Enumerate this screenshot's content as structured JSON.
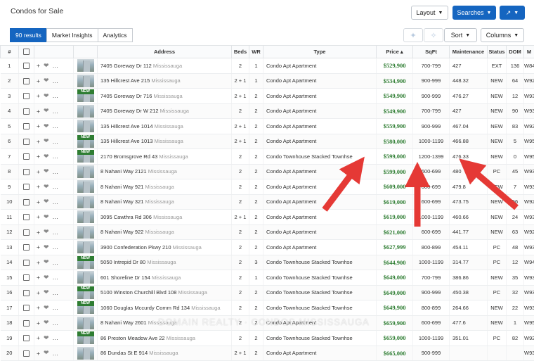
{
  "header": {
    "title": "Condos for Sale",
    "layout_label": "Layout",
    "searches_label": "Searches",
    "share_icon_label": "↗"
  },
  "tabs": [
    {
      "label": "90 results",
      "active": true
    },
    {
      "label": "Market Insights",
      "active": false
    },
    {
      "label": "Analytics",
      "active": false
    }
  ],
  "toolbar": {
    "sort_label": "Sort",
    "columns_label": "Columns"
  },
  "columns": [
    "#",
    "",
    "",
    "",
    "Address",
    "Beds",
    "WR",
    "Type",
    "Price",
    "SqFt",
    "Maintenance",
    "Status",
    "DOM",
    "M"
  ],
  "sort_indicator": "▴",
  "rows": [
    {
      "n": "1",
      "new": false,
      "street": "7405 Goreway Dr 112",
      "city": "Mississauga",
      "beds": "2",
      "wr": "1",
      "type": "Condo Apt Apartment",
      "price": "$529,900",
      "sqft": "700-799",
      "maint": "427",
      "status": "EXT",
      "dom": "136",
      "mls": "W8442"
    },
    {
      "n": "2",
      "new": false,
      "street": "135 Hillcrest Ave 215",
      "city": "Mississauga",
      "beds": "2 + 1",
      "wr": "1",
      "type": "Condo Apt Apartment",
      "price": "$534,900",
      "sqft": "900-999",
      "maint": "448.32",
      "status": "NEW",
      "dom": "64",
      "mls": "W9269"
    },
    {
      "n": "3",
      "new": true,
      "street": "7405 Goreway Dr 716",
      "city": "Mississauga",
      "beds": "2 + 1",
      "wr": "2",
      "type": "Condo Apt Apartment",
      "price": "$549,900",
      "sqft": "900-999",
      "maint": "476.27",
      "status": "NEW",
      "dom": "12",
      "mls": "W9398"
    },
    {
      "n": "4",
      "new": false,
      "street": "7405 Goreway Dr W 212",
      "city": "Mississauga",
      "beds": "2",
      "wr": "2",
      "type": "Condo Apt Apartment",
      "price": "$549,900",
      "sqft": "700-799",
      "maint": "427",
      "status": "NEW",
      "dom": "90",
      "mls": "W9324"
    },
    {
      "n": "5",
      "new": false,
      "street": "135 Hillcrest Ave 1014",
      "city": "Mississauga",
      "beds": "2 + 1",
      "wr": "2",
      "type": "Condo Apt Apartment",
      "price": "$559,900",
      "sqft": "900-999",
      "maint": "467.04",
      "status": "NEW",
      "dom": "83",
      "mls": "W924"
    },
    {
      "n": "6",
      "new": true,
      "street": "135 Hillcrest Ave 1013",
      "city": "Mississauga",
      "beds": "2 + 1",
      "wr": "2",
      "type": "Condo Apt Apartment",
      "price": "$580,000",
      "sqft": "1000-1199",
      "maint": "466.88",
      "status": "NEW",
      "dom": "5",
      "mls": "W9506"
    },
    {
      "n": "7",
      "new": true,
      "street": "2170 Bromsgrove Rd 43",
      "city": "Mississauga",
      "beds": "2",
      "wr": "2",
      "type": "Condo Townhouse Stacked Townhse",
      "price": "$599,000",
      "sqft": "1200-1399",
      "maint": "476.33",
      "status": "NEW",
      "dom": "0",
      "mls": "W951"
    },
    {
      "n": "8",
      "new": false,
      "street": "8 Nahani Way 2121",
      "city": "Mississauga",
      "beds": "2",
      "wr": "2",
      "type": "Condo Apt Apartment",
      "price": "$599,000",
      "sqft": "600-699",
      "maint": "480",
      "status": "PC",
      "dom": "45",
      "mls": "W934"
    },
    {
      "n": "9",
      "new": false,
      "street": "8 Nahani Way 921",
      "city": "Mississauga",
      "beds": "2",
      "wr": "2",
      "type": "Condo Apt Apartment",
      "price": "$609,000",
      "sqft": "600-699",
      "maint": "479.8",
      "status": "NEW",
      "dom": "7",
      "mls": "W930"
    },
    {
      "n": "10",
      "new": false,
      "street": "8 Nahani Way 321",
      "city": "Mississauga",
      "beds": "2",
      "wr": "2",
      "type": "Condo Apt Apartment",
      "price": "$619,000",
      "sqft": "600-699",
      "maint": "473.75",
      "status": "NEW",
      "dom": "56",
      "mls": "W929"
    },
    {
      "n": "11",
      "new": false,
      "street": "3095 Cawthra Rd 306",
      "city": "Mississauga",
      "beds": "2 + 1",
      "wr": "2",
      "type": "Condo Apt Apartment",
      "price": "$619,000",
      "sqft": "1000-1199",
      "maint": "460.66",
      "status": "NEW",
      "dom": "24",
      "mls": "W938"
    },
    {
      "n": "12",
      "new": false,
      "street": "8 Nahani Way 922",
      "city": "Mississauga",
      "beds": "2",
      "wr": "2",
      "type": "Condo Apt Apartment",
      "price": "$621,000",
      "sqft": "600-699",
      "maint": "441.77",
      "status": "NEW",
      "dom": "63",
      "mls": "W927"
    },
    {
      "n": "13",
      "new": false,
      "street": "3900 Confederation Pkwy 210",
      "city": "Mississauga",
      "beds": "2",
      "wr": "2",
      "type": "Condo Apt Apartment",
      "price": "$627,999",
      "sqft": "800-899",
      "maint": "454.11",
      "status": "PC",
      "dom": "48",
      "mls": "W934"
    },
    {
      "n": "14",
      "new": true,
      "street": "5050 Intrepid Dr 80",
      "city": "Mississauga",
      "beds": "2",
      "wr": "3",
      "type": "Condo Townhouse Stacked Townhse",
      "price": "$644,900",
      "sqft": "1000-1199",
      "maint": "314.77",
      "status": "PC",
      "dom": "12",
      "mls": "W941"
    },
    {
      "n": "15",
      "new": false,
      "street": "601 Shoreline Dr 154",
      "city": "Mississauga",
      "beds": "2",
      "wr": "1",
      "type": "Condo Townhouse Stacked Townhse",
      "price": "$649,000",
      "sqft": "700-799",
      "maint": "386.86",
      "status": "NEW",
      "dom": "35",
      "mls": "W936"
    },
    {
      "n": "16",
      "new": true,
      "street": "5100 Winston Churchill Blvd 108",
      "city": "Mississauga",
      "beds": "2",
      "wr": "2",
      "type": "Condo Townhouse Stacked Townhse",
      "price": "$649,000",
      "sqft": "900-999",
      "maint": "450.38",
      "status": "PC",
      "dom": "32",
      "mls": "W936"
    },
    {
      "n": "17",
      "new": true,
      "street": "1060 Douglas Mccurdy Comm Rd 134",
      "city": "Mississauga",
      "beds": "2",
      "wr": "2",
      "type": "Condo Townhouse Stacked Townhse",
      "price": "$649,900",
      "sqft": "800-899",
      "maint": "264.66",
      "status": "NEW",
      "dom": "22",
      "mls": "W930"
    },
    {
      "n": "18",
      "new": false,
      "street": "8 Nahani Way 2601",
      "city": "Mississauga",
      "beds": "2",
      "wr": "2",
      "type": "Condo Apt Apartment",
      "price": "$659,900",
      "sqft": "600-699",
      "maint": "477.6",
      "status": "NEW",
      "dom": "1",
      "mls": "W951"
    },
    {
      "n": "19",
      "new": true,
      "street": "86 Preston Meadow Ave 22",
      "city": "Mississauga",
      "beds": "2",
      "wr": "2",
      "type": "Condo Townhouse Stacked Townhse",
      "price": "$659,000",
      "sqft": "1000-1199",
      "maint": "351.01",
      "status": "PC",
      "dom": "82",
      "mls": "W924"
    },
    {
      "n": "20",
      "new": false,
      "street": "86 Dundas St E 914",
      "city": "Mississauga",
      "beds": "2 + 1",
      "wr": "2",
      "type": "Condo Apt Apartment",
      "price": "$665,000",
      "sqft": "900-999",
      "maint": "",
      "status": "",
      "dom": "",
      "mls": "W934"
    }
  ],
  "new_badge": "NEW",
  "watermark": "DOMAIN REALTY · CONDOS MISSISSAUGA",
  "colors": {
    "accent": "#1565c0",
    "price": "#2e7d32",
    "arrow": "#e53935"
  }
}
